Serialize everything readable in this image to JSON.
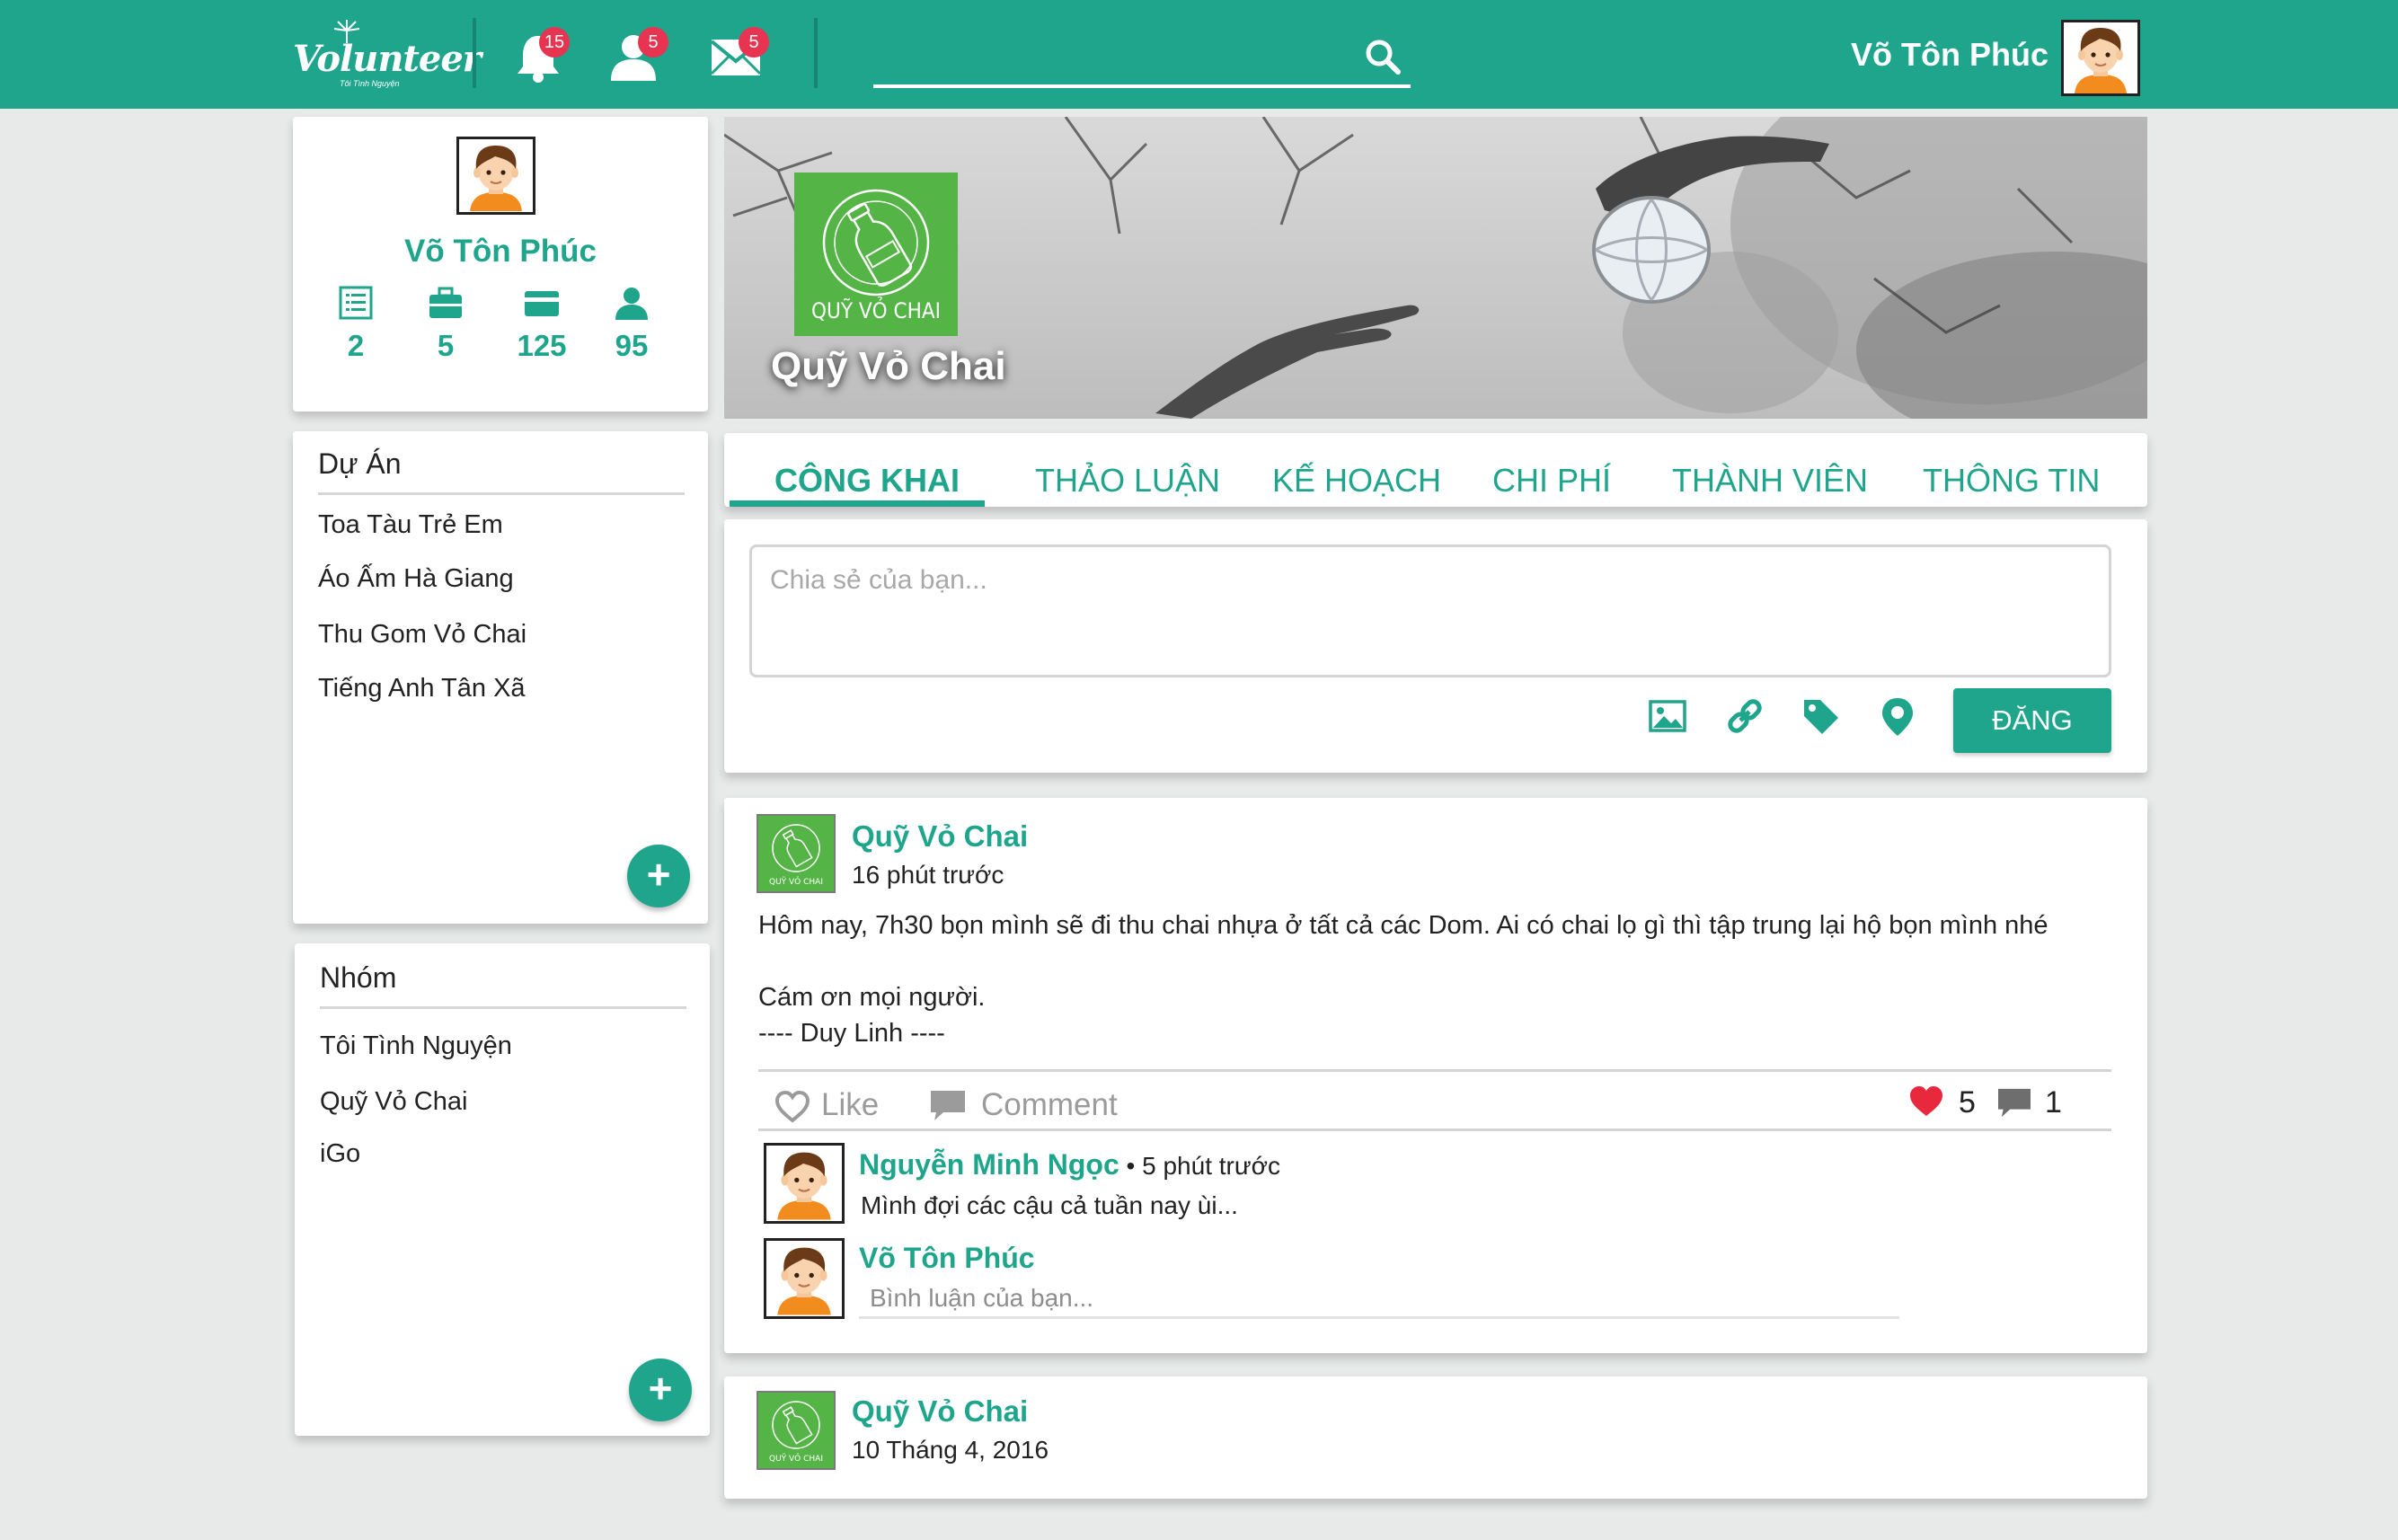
{
  "header": {
    "logo_text": "Volunteer",
    "logo_tagline": "Tôi Tình Nguyện",
    "notifications_count": "15",
    "friends_count": "5",
    "messages_count": "5",
    "search_placeholder": "",
    "user_name": "Võ Tôn Phúc",
    "brand_color": "#1ea58c",
    "badge_color": "#e63451"
  },
  "profile": {
    "name": "Võ Tôn Phúc",
    "stats": [
      {
        "icon": "list-icon",
        "value": "2"
      },
      {
        "icon": "briefcase-icon",
        "value": "5"
      },
      {
        "icon": "card-icon",
        "value": "125"
      },
      {
        "icon": "user-icon",
        "value": "95"
      }
    ]
  },
  "projects": {
    "title": "Dự Án",
    "items": [
      "Toa Tàu Trẻ Em",
      "Áo Ấm Hà Giang",
      "Thu Gom Vỏ Chai",
      "Tiếng Anh Tân Xã"
    ],
    "add_label": "+"
  },
  "groups": {
    "title": "Nhóm",
    "items": [
      "Tôi Tình Nguyện",
      "Quỹ Vỏ Chai",
      "iGo"
    ],
    "add_label": "+"
  },
  "cover": {
    "group_name": "Quỹ Vỏ Chai",
    "logo_label": "QUỸ VỎ CHAI",
    "logo_color": "#55b446"
  },
  "tabs": [
    "CÔNG KHAI",
    "THẢO LUẬN",
    "KẾ HOẠCH",
    "CHI PHÍ",
    "THÀNH VIÊN",
    "THÔNG TIN"
  ],
  "active_tab": "CÔNG KHAI",
  "composer": {
    "placeholder": "Chia sẻ của bạn...",
    "post_label": "ĐĂNG"
  },
  "posts": [
    {
      "author": "Quỹ Vỏ Chai",
      "time": "16 phút trước",
      "lines": [
        "Hôm nay, 7h30 bọn mình sẽ đi thu chai nhựa ở tất cả các Dom. Ai có chai lọ gì thì tập trung lại hộ bọn mình nhé",
        "Cám ơn mọi người.",
        "---- Duy Linh ----"
      ],
      "like_label": "Like",
      "comment_label": "Comment",
      "likes": "5",
      "comments": "1",
      "comment_items": [
        {
          "author": "Nguyễn Minh Ngọc",
          "meta": " • 5 phút trước",
          "text": "Mình đợi các cậu cả tuần nay ùi..."
        }
      ],
      "reply": {
        "author": "Võ Tôn Phúc",
        "placeholder": "Bình luận của bạn..."
      }
    },
    {
      "author": "Quỹ Vỏ Chai",
      "time": "10  Tháng 4, 2016"
    }
  ]
}
